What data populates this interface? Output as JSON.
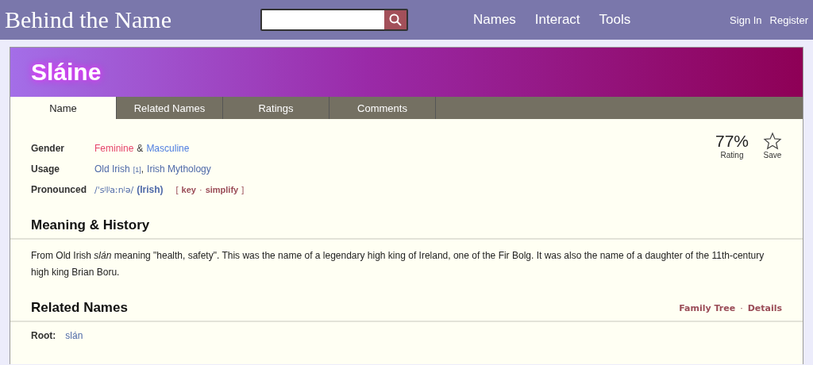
{
  "header": {
    "logo": "Behind the Name",
    "nav": [
      "Names",
      "Interact",
      "Tools"
    ],
    "account": [
      "Sign In",
      "Register"
    ]
  },
  "name": {
    "title": "Sláine"
  },
  "tabs": [
    {
      "label": "Name",
      "selected": true
    },
    {
      "label": "Related Names",
      "selected": false
    },
    {
      "label": "Ratings",
      "selected": false
    },
    {
      "label": "Comments",
      "selected": false
    }
  ],
  "rating": {
    "value": "77%",
    "label": "Rating"
  },
  "save": {
    "label": "Save",
    "saved": false
  },
  "info": {
    "gender": {
      "label": "Gender",
      "values": [
        {
          "text": "Feminine",
          "color": "#e6456a"
        },
        {
          "text": "Masculine",
          "color": "#4f7ee0"
        }
      ],
      "joiner": "&"
    },
    "usage": {
      "label": "Usage",
      "items": [
        {
          "text": "Old Irish",
          "ref": "[1]"
        },
        {
          "text": "Irish Mythology"
        }
      ],
      "separator": ","
    },
    "pronounced": {
      "label": "Pronounced",
      "ipa": "/ˈsʲlʲaːnʲə/",
      "language": "(Irish)",
      "links": [
        "key",
        "simplify"
      ],
      "open": "[",
      "close": "]",
      "dot": "·"
    }
  },
  "meaning": {
    "heading": "Meaning & History",
    "text": "From Old Irish *slán* meaning \"health, safety\". This was the name of a legendary high king of Ireland, one of the Fir Bolg. It was also the name of a daughter of the 11th-century high king Brian Boru."
  },
  "related": {
    "heading": "Related Names",
    "links": [
      "Family Tree",
      "Details"
    ],
    "dot": "·",
    "root_label": "Root:",
    "root": "slán"
  }
}
